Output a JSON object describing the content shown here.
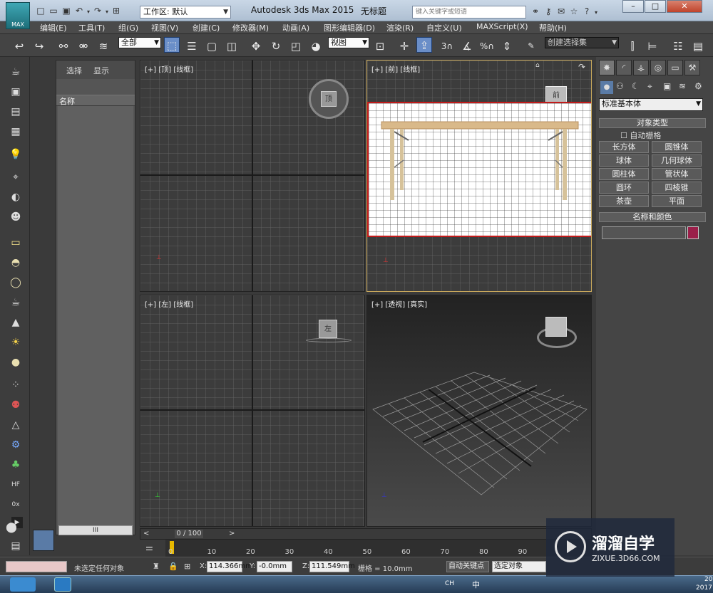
{
  "titlebar": {
    "logo_text": "MAX",
    "workspace_value": "工作区: 默认",
    "app_title": "Autodesk 3ds Max  2015",
    "document_title": "无标题",
    "search_placeholder": "键入关键字或短语"
  },
  "menubar": {
    "items": [
      "编辑(E)",
      "工具(T)",
      "组(G)",
      "视图(V)",
      "创建(C)",
      "修改器(M)",
      "动画(A)",
      "图形编辑器(D)",
      "渲染(R)",
      "自定义(U)",
      "MAXScript(X)",
      "帮助(H)"
    ]
  },
  "toolbar": {
    "selection_filter": "全部",
    "reference_coord": "视图",
    "named_selection_placeholder": "创建选择集",
    "snap_label": "3",
    "angle_snap_label": "%"
  },
  "scene_explorer": {
    "tabs": [
      "选择",
      "显示"
    ],
    "column_header": "名称",
    "scrollbar_label": "III"
  },
  "viewports": {
    "top": {
      "label": "[+] [顶] [线框]",
      "cube_text": "顶"
    },
    "front": {
      "label": "[+] [前] [线框]",
      "cube_text": "前"
    },
    "left": {
      "label": "[+] [左] [线框]",
      "cube_text": "左"
    },
    "perspective": {
      "label": "[+] [透视] [真实]"
    }
  },
  "command_panel": {
    "category": "标准基本体",
    "object_type_title": "对象类型",
    "autogrid_label": "自动栅格",
    "object_buttons": [
      "长方体",
      "圆锥体",
      "球体",
      "几何球体",
      "圆柱体",
      "管状体",
      "圆环",
      "四棱锥",
      "茶壶",
      "平面"
    ],
    "name_color_title": "名称和颜色",
    "color_swatch": "#9b1f4a"
  },
  "timeline": {
    "slider_text": "0 / 100",
    "ticks": [
      "0",
      "10",
      "20",
      "30",
      "40",
      "50",
      "60",
      "70",
      "80",
      "90"
    ]
  },
  "statusbar": {
    "selection_status": "未选定任何对象",
    "x_label": "X:",
    "x_value": "114.366mm",
    "y_label": "Y:",
    "y_value": "-0.0mm",
    "z_label": "Z:",
    "z_value": "111.549mm",
    "grid_label": "栅格 = 10.0mm",
    "autokey_label": "自动关键点",
    "selected_object": "选定对象"
  },
  "taskbar": {
    "lang": "CH",
    "ime": "中",
    "clock_top": "20",
    "clock_bottom": "2017"
  },
  "watermark": {
    "title": "溜溜自学",
    "url": "ZIXUE.3D66.COM"
  }
}
